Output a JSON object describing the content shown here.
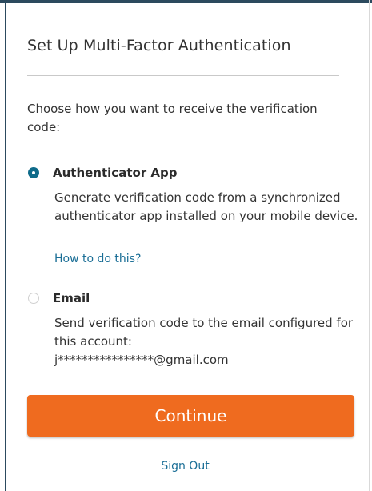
{
  "dialog": {
    "title": "Set Up Multi-Factor Authentication",
    "prompt": "Choose how you want to receive the verification code:"
  },
  "options": [
    {
      "label": "Authenticator App",
      "description": "Generate verification code from a synchronized authenticator app installed on your mobile device.",
      "link": "How to do this?",
      "selected": true
    },
    {
      "label": "Email",
      "description_line1": "Send verification code to the email configured for this account:",
      "email": "j****************@gmail.com",
      "selected": false
    }
  ],
  "actions": {
    "continue_label": "Continue",
    "signout_label": "Sign Out"
  },
  "colors": {
    "accent": "#ef6b1f",
    "link": "#1a6e96",
    "radio_selected": "#0f6b8a"
  }
}
